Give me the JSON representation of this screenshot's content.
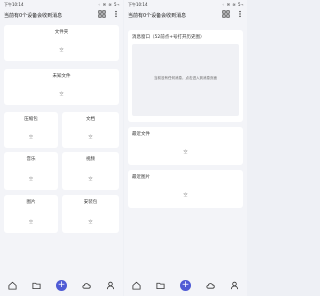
{
  "status": {
    "time": "下午10:14",
    "icons": "◦ ✉ ≋ 5⌁"
  },
  "left": {
    "title": "当前有0个设备会收到消息",
    "cards": [
      {
        "id": "folder",
        "title": "文件夹",
        "empty": "空"
      },
      {
        "id": "received",
        "title": "未知文件",
        "empty": "空"
      },
      {
        "id": "archive",
        "title": "压缩包",
        "empty": "空"
      },
      {
        "id": "docs",
        "title": "文档",
        "empty": "空"
      },
      {
        "id": "music",
        "title": "音乐",
        "empty": "空"
      },
      {
        "id": "video",
        "title": "视频",
        "empty": "空"
      },
      {
        "id": "images",
        "title": "图片",
        "empty": "空"
      },
      {
        "id": "apk",
        "title": "安装包",
        "empty": "空"
      }
    ]
  },
  "right": {
    "title": "当前有0个设备会收到消息",
    "message": {
      "title": "消息窗口（52前点+号打开历史图）",
      "text": "当前没有任何消息，点击进入到消息页面"
    },
    "recent_files": {
      "title": "最近文件",
      "empty": "空"
    },
    "recent_images": {
      "title": "最近图片",
      "empty": "空"
    }
  },
  "nav": {
    "plus": "+"
  },
  "colors": {
    "accent": "#4f5bd5",
    "background": "#f3f4f8",
    "card": "#ffffff"
  }
}
